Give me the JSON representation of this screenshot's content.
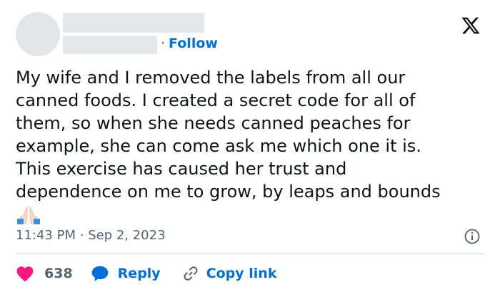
{
  "header": {
    "follow_label": "Follow",
    "follow_separator": "·"
  },
  "tweet": {
    "lines": [
      "My wife and I removed the labels from all our",
      "canned foods. I created a secret code for all of",
      "them, so when she needs canned peaches for",
      "example, she can come ask me which one it is.",
      "This exercise has caused her trust and",
      "dependence on me to grow, by leaps and bounds"
    ],
    "emoji": "folded-hands-emoji",
    "time": "11:43 PM",
    "date_separator": "·",
    "date": "Sep 2, 2023"
  },
  "actions": {
    "like_count": "638",
    "reply_label": "Reply",
    "copy_link_label": "Copy link"
  },
  "colors": {
    "link_blue": "#006fd6",
    "heart_red": "#f91880",
    "muted_gray": "#536471",
    "redaction_gray": "#e6e8eb"
  },
  "icons": {
    "brand": "x-logo-icon",
    "info": "info-icon",
    "like": "heart-icon",
    "reply": "reply-bubble-icon",
    "copy": "link-icon"
  }
}
